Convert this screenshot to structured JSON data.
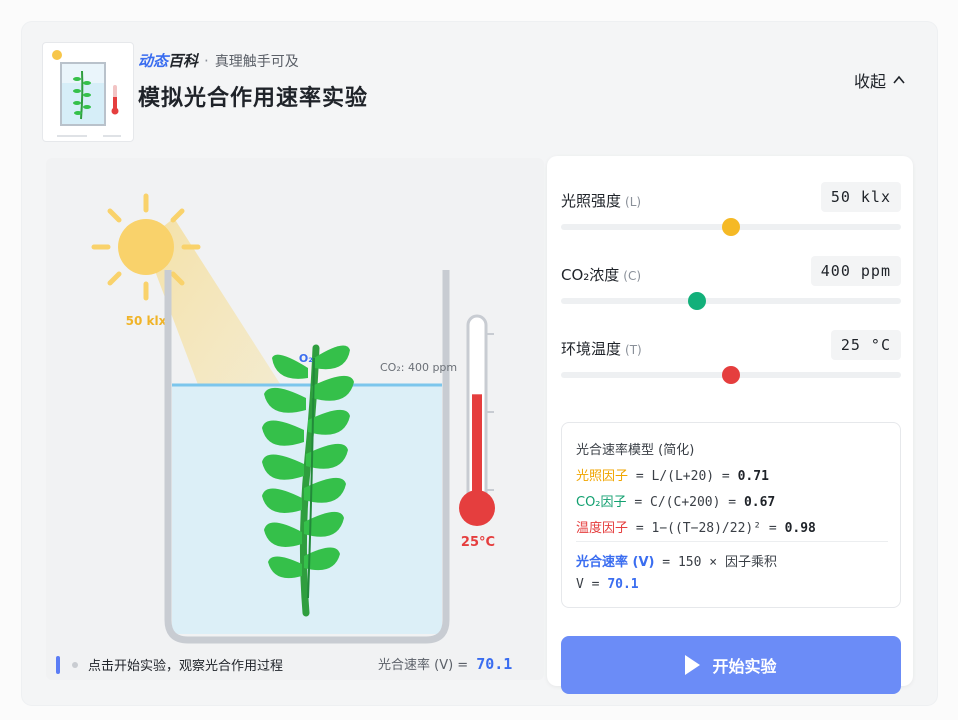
{
  "header": {
    "brand_part1": "动态",
    "brand_part2": "百科",
    "separator": "·",
    "slogan": "真理触手可及",
    "title": "模拟光合作用速率实验",
    "collapse_label": "收起"
  },
  "stage": {
    "light_label": "50 klx",
    "o2_label": "O₂",
    "co2_label": "CO₂: 400 ppm",
    "temp_label": "25°C",
    "thermometer_level": 0.55,
    "hint": "点击开始实验，观察光合作用过程",
    "rate_label": "光合速率 (V) =",
    "rate_value": "70.1"
  },
  "controls": [
    {
      "label": "光照强度",
      "abbr": "(L)",
      "value": "50 klx",
      "fraction": 0.5,
      "color": "#f5b925"
    },
    {
      "label": "CO₂浓度",
      "abbr": "(C)",
      "value": "400 ppm",
      "fraction": 0.4,
      "color": "#12b07a"
    },
    {
      "label": "环境温度",
      "abbr": "(T)",
      "value": "25 °C",
      "fraction": 0.5,
      "color": "#e53e3e"
    }
  ],
  "model": {
    "title": "光合速率模型 (简化)",
    "light_name": "光照因子",
    "light_formula": " = L/(L+20) = ",
    "light_value": "0.71",
    "co2_name": "CO₂因子",
    "co2_formula": " = C/(C+200) = ",
    "co2_value": "0.67",
    "temp_name": "温度因子",
    "temp_formula": " = 1−((T−28)/22)² = ",
    "temp_value": "0.98",
    "rate_name": "光合速率 (V)",
    "rate_formula": " = 150 × ",
    "rate_tail": "因子乘积",
    "v_label": "V = ",
    "v_value": "70.1"
  },
  "start_button": "开始实验",
  "colors": {
    "accent": "#3a6df0",
    "light": "#f5b925",
    "co2": "#12b07a",
    "temp": "#e53e3e",
    "leaf": "#35c04a"
  }
}
